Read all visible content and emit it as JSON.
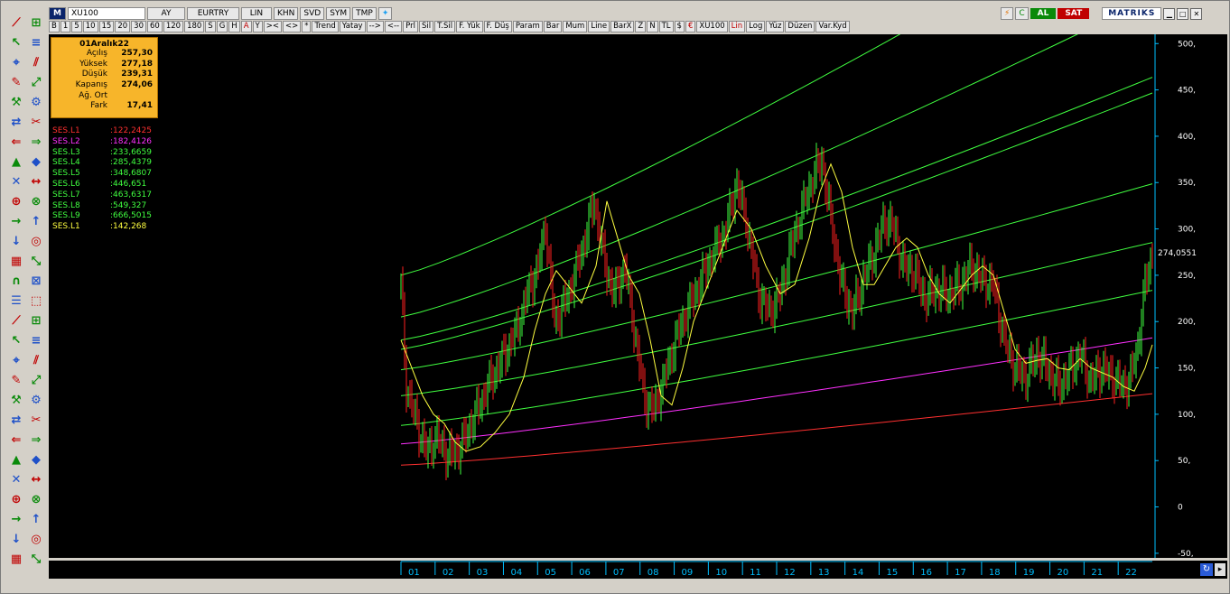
{
  "toolbar": {
    "m_label": "M",
    "symbol": "XU100",
    "period": "AY",
    "currency": "EURTRY",
    "scale": "LIN",
    "khn": "KHN",
    "svd": "SVD",
    "sym": "SYM",
    "tmp": "TMP",
    "row2": [
      "B",
      "1",
      "5",
      "10",
      "15",
      "20",
      "30",
      "60",
      "120",
      "180",
      "S",
      "G",
      "H",
      "A",
      "Y",
      "><",
      "<>",
      "*",
      "Trend",
      "Yatay",
      "-->",
      "<--",
      "Prl",
      "Sil",
      "T.Sil",
      "F. Yük",
      "F. Düş",
      "Param",
      "Bar",
      "Mum",
      "Line",
      "BarX",
      "Z",
      "N",
      "TL",
      "$",
      "€",
      "XU100",
      "Lin",
      "Log",
      "Yüz",
      "Düzen",
      "Var.Kyd"
    ],
    "al": "AL",
    "sat": "SAT",
    "brand": "MATRIKS"
  },
  "info": {
    "date": "01Aralık22",
    "rows": [
      {
        "k": "Açılış",
        "v": "257,30"
      },
      {
        "k": "Yüksek",
        "v": "277,18"
      },
      {
        "k": "Düşük",
        "v": "239,31"
      },
      {
        "k": "Kapanış",
        "v": "274,06"
      },
      {
        "k": "Ağ. Ort",
        "v": ""
      },
      {
        "k": "Fark",
        "v": "17,41"
      }
    ]
  },
  "ses": [
    {
      "n": "SES.L1",
      "v": ":122,2425",
      "color": "#ff3030"
    },
    {
      "n": "SES.L2",
      "v": ":182,4126",
      "color": "#ff30ff"
    },
    {
      "n": "SES.L3",
      "v": ":233,6659",
      "color": "#40ff40"
    },
    {
      "n": "SES.L4",
      "v": ":285,4379",
      "color": "#40ff40"
    },
    {
      "n": "SES.L5",
      "v": ":348,6807",
      "color": "#40ff40"
    },
    {
      "n": "SES.L6",
      "v": ":446,651",
      "color": "#40ff40"
    },
    {
      "n": "SES.L7",
      "v": ":463,6317",
      "color": "#40ff40"
    },
    {
      "n": "SES.L8",
      "v": ":549,327",
      "color": "#40ff40"
    },
    {
      "n": "SES.L9",
      "v": ":666,5015",
      "color": "#40ff40"
    },
    {
      "n": "SES.L1",
      "v": ":142,268",
      "color": "#ffff40"
    }
  ],
  "chart_data": {
    "type": "line",
    "y_ticks": [
      "500,",
      "450,",
      "400,",
      "350,",
      "300,",
      "250,",
      "200,",
      "150,",
      "100,",
      "50,",
      "0",
      "-50,"
    ],
    "y_values": [
      500,
      450,
      400,
      350,
      300,
      250,
      200,
      150,
      100,
      50,
      0,
      -50
    ],
    "ylim": [
      -55,
      510
    ],
    "x_ticks": [
      "01",
      "02",
      "03",
      "04",
      "05",
      "06",
      "07",
      "08",
      "09",
      "10",
      "11",
      "12",
      "13",
      "14",
      "15",
      "16",
      "17",
      "18",
      "19",
      "20",
      "21",
      "22"
    ],
    "last_price_label": "274,0551",
    "last_price": 274.06,
    "close_path": [
      [
        0,
        240
      ],
      [
        3,
        130
      ],
      [
        8,
        95
      ],
      [
        14,
        60
      ],
      [
        20,
        75
      ],
      [
        26,
        55
      ],
      [
        33,
        65
      ],
      [
        40,
        95
      ],
      [
        48,
        130
      ],
      [
        56,
        160
      ],
      [
        64,
        190
      ],
      [
        70,
        230
      ],
      [
        76,
        260
      ],
      [
        80,
        305
      ],
      [
        85,
        200
      ],
      [
        92,
        225
      ],
      [
        100,
        275
      ],
      [
        107,
        330
      ],
      [
        113,
        260
      ],
      [
        118,
        230
      ],
      [
        124,
        260
      ],
      [
        130,
        180
      ],
      [
        135,
        115
      ],
      [
        140,
        105
      ],
      [
        146,
        140
      ],
      [
        152,
        180
      ],
      [
        158,
        210
      ],
      [
        165,
        240
      ],
      [
        172,
        270
      ],
      [
        180,
        300
      ],
      [
        186,
        350
      ],
      [
        192,
        300
      ],
      [
        198,
        230
      ],
      [
        204,
        210
      ],
      [
        210,
        230
      ],
      [
        216,
        280
      ],
      [
        222,
        320
      ],
      [
        228,
        355
      ],
      [
        233,
        375
      ],
      [
        238,
        310
      ],
      [
        244,
        240
      ],
      [
        250,
        210
      ],
      [
        256,
        245
      ],
      [
        262,
        275
      ],
      [
        268,
        310
      ],
      [
        273,
        300
      ],
      [
        278,
        260
      ],
      [
        284,
        255
      ],
      [
        290,
        225
      ],
      [
        296,
        235
      ],
      [
        303,
        230
      ],
      [
        310,
        240
      ],
      [
        316,
        260
      ],
      [
        322,
        245
      ],
      [
        328,
        240
      ],
      [
        334,
        180
      ],
      [
        340,
        150
      ],
      [
        346,
        140
      ],
      [
        352,
        165
      ],
      [
        358,
        150
      ],
      [
        364,
        130
      ],
      [
        370,
        145
      ],
      [
        376,
        165
      ],
      [
        382,
        135
      ],
      [
        388,
        150
      ],
      [
        394,
        140
      ],
      [
        400,
        130
      ],
      [
        404,
        140
      ],
      [
        408,
        175
      ],
      [
        412,
        240
      ],
      [
        416,
        274
      ]
    ],
    "ma_path": [
      [
        0,
        180
      ],
      [
        6,
        150
      ],
      [
        12,
        120
      ],
      [
        18,
        100
      ],
      [
        24,
        90
      ],
      [
        30,
        70
      ],
      [
        36,
        60
      ],
      [
        44,
        65
      ],
      [
        52,
        80
      ],
      [
        60,
        100
      ],
      [
        68,
        140
      ],
      [
        74,
        190
      ],
      [
        80,
        230
      ],
      [
        86,
        255
      ],
      [
        92,
        240
      ],
      [
        100,
        220
      ],
      [
        108,
        260
      ],
      [
        114,
        330
      ],
      [
        120,
        290
      ],
      [
        126,
        250
      ],
      [
        132,
        230
      ],
      [
        138,
        180
      ],
      [
        144,
        120
      ],
      [
        150,
        110
      ],
      [
        156,
        150
      ],
      [
        162,
        200
      ],
      [
        170,
        240
      ],
      [
        178,
        280
      ],
      [
        186,
        320
      ],
      [
        194,
        300
      ],
      [
        202,
        260
      ],
      [
        210,
        230
      ],
      [
        218,
        240
      ],
      [
        226,
        290
      ],
      [
        232,
        340
      ],
      [
        238,
        370
      ],
      [
        244,
        340
      ],
      [
        250,
        280
      ],
      [
        256,
        240
      ],
      [
        262,
        240
      ],
      [
        268,
        260
      ],
      [
        274,
        280
      ],
      [
        280,
        290
      ],
      [
        286,
        280
      ],
      [
        292,
        250
      ],
      [
        298,
        230
      ],
      [
        304,
        220
      ],
      [
        310,
        235
      ],
      [
        316,
        250
      ],
      [
        322,
        260
      ],
      [
        328,
        250
      ],
      [
        334,
        210
      ],
      [
        340,
        170
      ],
      [
        346,
        155
      ],
      [
        352,
        158
      ],
      [
        358,
        160
      ],
      [
        364,
        150
      ],
      [
        370,
        148
      ],
      [
        376,
        160
      ],
      [
        382,
        150
      ],
      [
        388,
        145
      ],
      [
        394,
        140
      ],
      [
        400,
        130
      ],
      [
        406,
        125
      ],
      [
        412,
        150
      ],
      [
        416,
        175
      ]
    ],
    "channels": [
      {
        "name": "SES.L1",
        "color": "#ff3030",
        "start": 45,
        "end": 122.2
      },
      {
        "name": "SES.L2",
        "color": "#ff30ff",
        "start": 68,
        "end": 182.4
      },
      {
        "name": "SES.L3",
        "color": "#40ff40",
        "start": 88,
        "end": 233.7
      },
      {
        "name": "SES.L4",
        "color": "#40ff40",
        "start": 120,
        "end": 285.4
      },
      {
        "name": "SES.L5",
        "color": "#40ff40",
        "start": 148,
        "end": 348.7
      },
      {
        "name": "SES.L6",
        "color": "#40ff40",
        "start": 170,
        "end": 446.7
      },
      {
        "name": "SES.L7",
        "color": "#40ff40",
        "start": 180,
        "end": 463.6
      },
      {
        "name": "SES.L8",
        "color": "#40ff40",
        "start": 205,
        "end": 549.3
      },
      {
        "name": "SES.L9",
        "color": "#40ff40",
        "start": 250,
        "end": 666.5
      }
    ]
  }
}
